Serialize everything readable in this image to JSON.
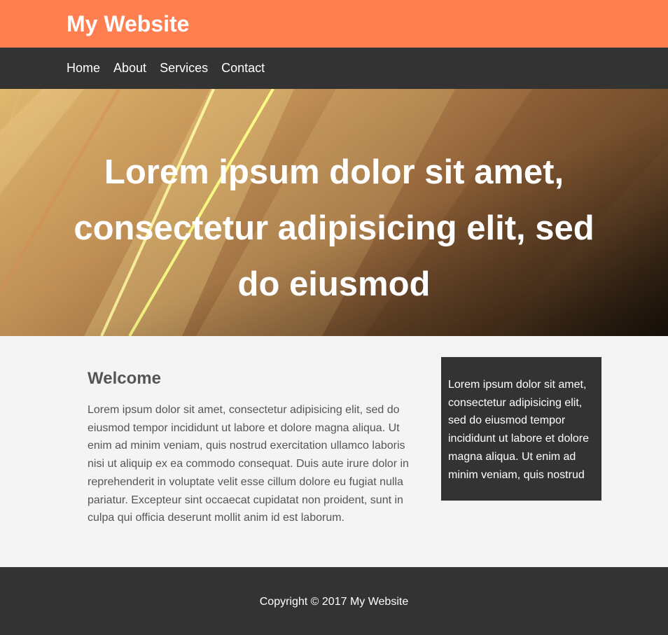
{
  "header": {
    "site_title": "My Website"
  },
  "nav": {
    "items": [
      {
        "label": "Home"
      },
      {
        "label": "About"
      },
      {
        "label": "Services"
      },
      {
        "label": "Contact"
      }
    ]
  },
  "hero": {
    "title": "Lorem ipsum dolor sit amet, consectetur adipisicing elit, sed do eiusmod"
  },
  "main": {
    "heading": "Welcome",
    "body": "Lorem ipsum dolor sit amet, consectetur adipisicing elit, sed do eiusmod tempor incididunt ut labore et dolore magna aliqua. Ut enim ad minim veniam, quis nostrud exercitation ullamco laboris nisi ut aliquip ex ea commodo consequat. Duis aute irure dolor in reprehenderit in voluptate velit esse cillum dolore eu fugiat nulla pariatur. Excepteur sint occaecat cupidatat non proident, sunt in culpa qui officia deserunt mollit anim id est laborum."
  },
  "sidebar": {
    "text": "Lorem ipsum dolor sit amet, consectetur adipisicing elit, sed do eiusmod tempor incididunt ut labore et dolore magna aliqua. Ut enim ad minim veniam, quis nostrud"
  },
  "footer": {
    "copyright": "Copyright © 2017 My Website"
  },
  "colors": {
    "header_bg": "#ff7f50",
    "dark_bg": "#333333",
    "page_bg": "#f4f4f4",
    "text": "#555555",
    "light_text": "#ffffff"
  }
}
